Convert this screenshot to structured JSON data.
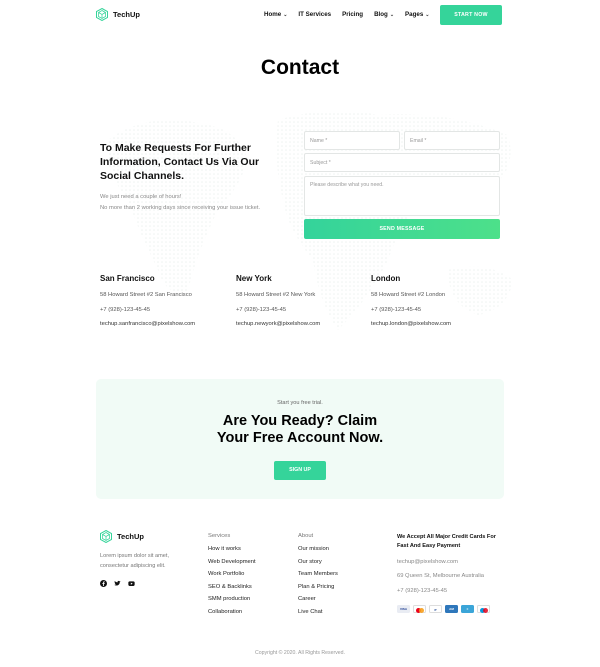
{
  "brand": {
    "name": "TechUp",
    "accent": "#35d49a"
  },
  "nav": {
    "items": [
      {
        "label": "Home",
        "dropdown": true
      },
      {
        "label": "IT Services",
        "dropdown": false
      },
      {
        "label": "Pricing",
        "dropdown": false
      },
      {
        "label": "Blog",
        "dropdown": true
      },
      {
        "label": "Pages",
        "dropdown": true
      }
    ],
    "cta_label": "START NOW"
  },
  "page": {
    "title": "Contact"
  },
  "contact": {
    "lead": "To Make Requests For Further Information, Contact Us Via Our Social Channels.",
    "sub_line1": "We just need a couple of hours!",
    "sub_line2": "No more than 2 working days since receiving your issue ticket."
  },
  "form": {
    "name_placeholder": "Name *",
    "email_placeholder": "Email *",
    "subject_placeholder": "Subject *",
    "message_placeholder": "Please describe what you need.",
    "submit_label": "SEND MESSAGE"
  },
  "offices": [
    {
      "city": "San Francisco",
      "address": "58 Howard Street #2 San Francisco",
      "phone": "+7 (928)-123-45-45",
      "email": "techup.sanfrancisco@pixelshow.com"
    },
    {
      "city": "New York",
      "address": "58 Howard Street #2 New York",
      "phone": "+7 (928)-123-45-45",
      "email": "techup.newyork@pixelshow.com"
    },
    {
      "city": "London",
      "address": "58 Howard Street #2 London",
      "phone": "+7 (928)-123-45-45",
      "email": "techup.london@pixelshow.com"
    }
  ],
  "cta": {
    "small": "Start you free trial.",
    "title_line1": "Are You Ready? Claim",
    "title_line2": "Your Free Account Now.",
    "button": "SIGN UP"
  },
  "footer": {
    "about_line1": "Lorem ipsum dolor sit amet,",
    "about_line2": "consectetur adipiscing elit.",
    "socials": [
      "facebook-icon",
      "twitter-icon",
      "youtube-icon"
    ],
    "services": {
      "heading": "Services",
      "items": [
        "How it works",
        "Web Development",
        "Work Portfolio",
        "SEO & Backlinks",
        "SMM production",
        "Collaboration"
      ]
    },
    "about": {
      "heading": "About",
      "items": [
        "Our mission",
        "Our story",
        "Team Members",
        "Plan & Pricing",
        "Career",
        "Live Chat"
      ]
    },
    "payments": {
      "heading": "We Accept All Major Credit Cards For Fast And Easy Payment",
      "email": "techup@pixelshow.com",
      "address": "69 Queen St, Melbourne Australia",
      "phone": "+7 (928)-123-45-45",
      "cards": [
        "visa-icon",
        "mastercard-icon",
        "paypal-icon",
        "amex-icon",
        "bank-transfer-icon",
        "maestro-icon"
      ]
    },
    "copyright": "Copyright © 2020.  All Rights Reserved."
  }
}
